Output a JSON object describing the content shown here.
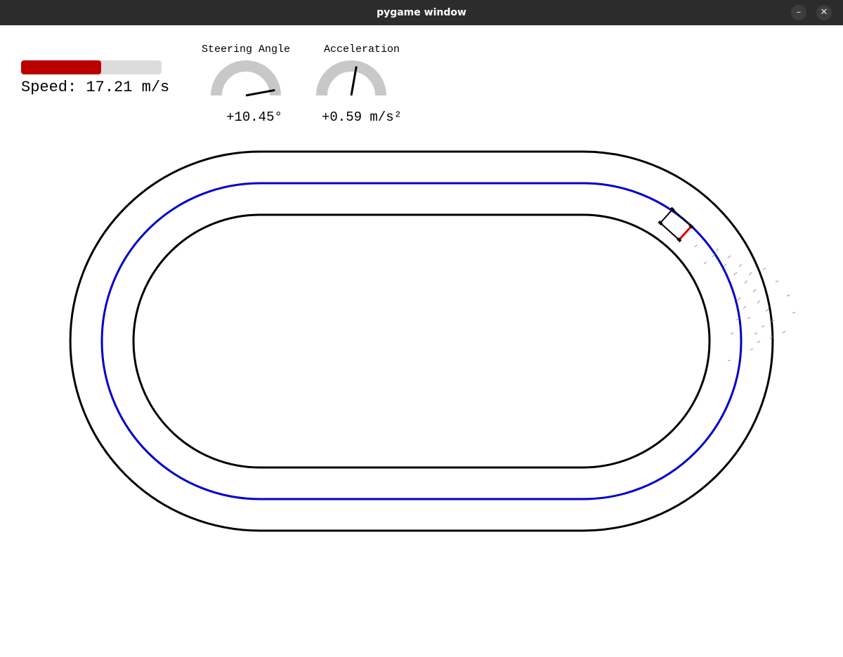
{
  "window": {
    "title": "pygame window",
    "minimize_icon": "minimize-icon",
    "close_icon": "close-icon",
    "minimize_glyph": "–",
    "close_glyph": "✕"
  },
  "hud": {
    "speed": {
      "label": "Speed: 17.21 m/s",
      "fill_fraction": 0.57,
      "fill_color": "#bb0000",
      "track_color": "#dcdcdc"
    },
    "steering": {
      "title": "Steering Angle",
      "value_text": "+10.45°",
      "angle_deg": 10.45
    },
    "acceleration": {
      "title": "Acceleration",
      "value_text": "+0.59 m/s²",
      "value": 0.59
    }
  },
  "colors": {
    "background": "#ffffff",
    "track_border": "#000000",
    "racing_line": "#0000cc",
    "gauge_arc": "#c8c8c8",
    "car_outline": "#000000",
    "car_front": "#dd0000"
  }
}
